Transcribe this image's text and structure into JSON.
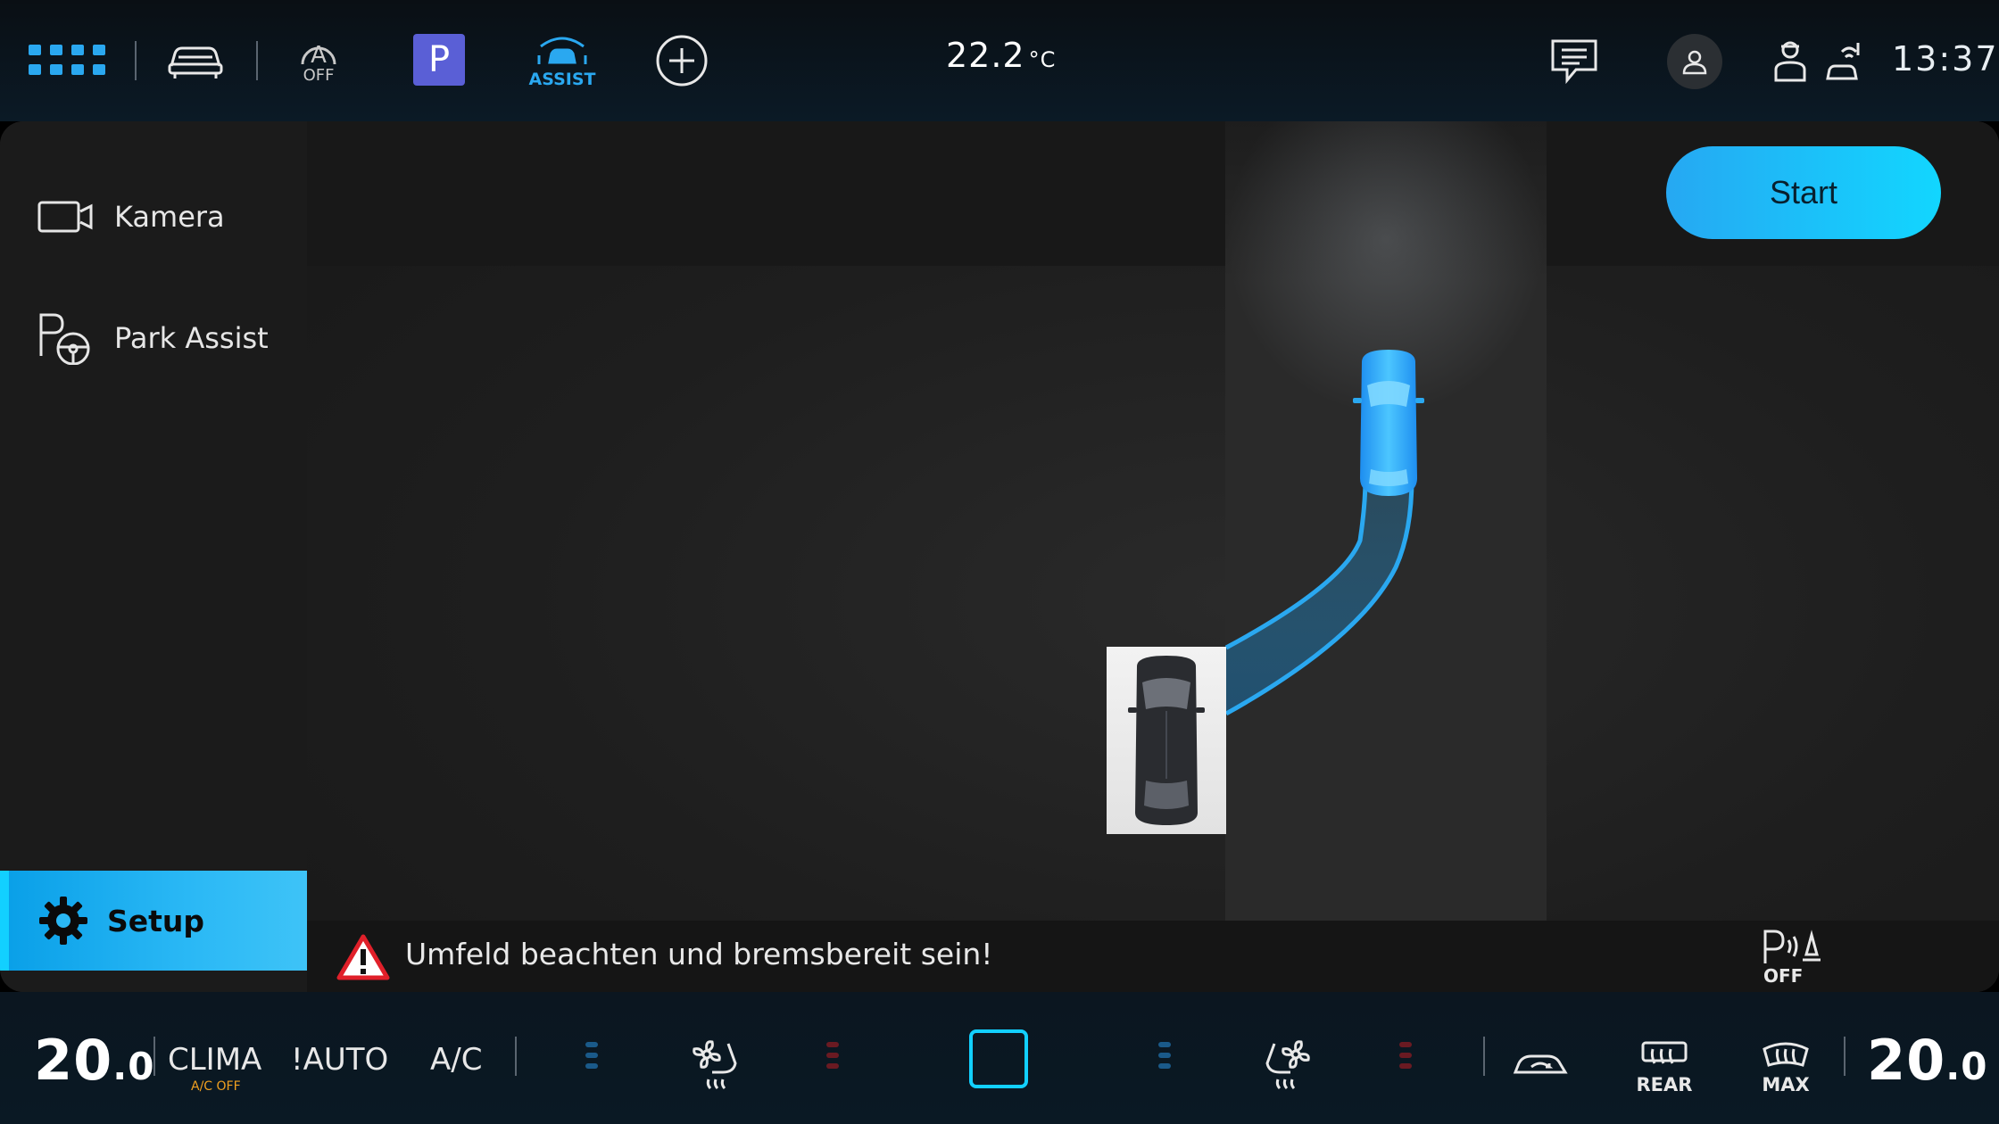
{
  "statusbar": {
    "auto_hold_label": "OFF",
    "park_label": "P",
    "assist_label": "ASSIST",
    "temperature": "22.2",
    "temperature_unit": "°C",
    "clock": "13:37"
  },
  "sidebar": {
    "items": [
      {
        "label": "Kamera",
        "icon": "camera-icon"
      },
      {
        "label": "Park Assist",
        "icon": "park-steering-icon"
      }
    ],
    "setup_label": "Setup"
  },
  "main": {
    "start_label": "Start",
    "warning_text": "Umfeld beachten und bremsbereit sein!",
    "park_sensor_label": "OFF",
    "park_sensor_letter": "P"
  },
  "climate": {
    "left_temp_int": "20",
    "left_temp_dec": ".0",
    "clima_label": "CLIMA",
    "clima_sub": "A/C OFF",
    "auto_label": "!AUTO",
    "ac_label": "A/C",
    "rear_label": "REAR",
    "max_label": "MAX",
    "right_temp_int": "20",
    "right_temp_dec": ".0"
  },
  "colors": {
    "accent": "#12d6ff",
    "assist_blue": "#2aa8f0",
    "park_purple": "#5a5fd6",
    "warning_red": "#e0202a",
    "clima_sub": "#f0a020"
  }
}
